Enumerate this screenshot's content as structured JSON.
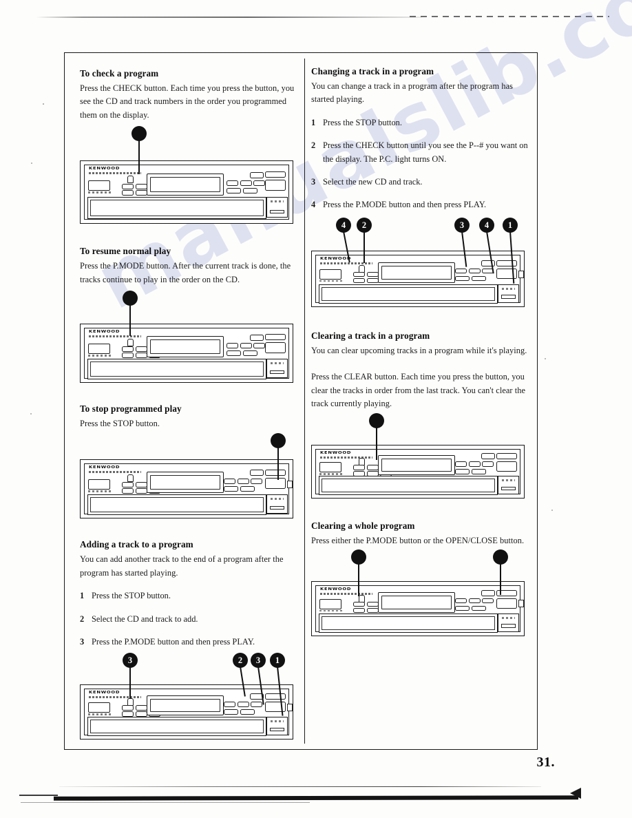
{
  "document": {
    "page_number": "31.",
    "watermark": "manualslib.com",
    "device_brand": "KENWOOD"
  },
  "left_column": {
    "sections": [
      {
        "id": "check-program",
        "heading": "To check a program",
        "body": "Press the CHECK button. Each time you press the button, you see the CD and track numbers in the order you programmed them on the display.",
        "steps": [],
        "callouts": [
          ""
        ]
      },
      {
        "id": "resume-normal-play",
        "heading": "To resume normal play",
        "body": "Press the P.MODE button. After the current track is done, the tracks continue to play in the order on the CD.",
        "steps": [],
        "callouts": [
          ""
        ]
      },
      {
        "id": "stop-programmed-play",
        "heading": "To stop programmed play",
        "body": "Press the STOP button.",
        "steps": [],
        "callouts": [
          ""
        ]
      },
      {
        "id": "adding-track",
        "heading": "Adding a track to a program",
        "body": "You can add another track to the end of a program after the program has started playing.",
        "steps": [
          {
            "num": "1",
            "text": "Press the STOP button."
          },
          {
            "num": "2",
            "text": "Select the CD and track to add."
          },
          {
            "num": "3",
            "text": "Press the P.MODE button and then press PLAY."
          }
        ],
        "callouts": [
          "3",
          "2",
          "3",
          "1"
        ]
      }
    ]
  },
  "right_column": {
    "sections": [
      {
        "id": "changing-track",
        "heading": "Changing a track in a program",
        "body": "You can change a track in a program after the program has started playing.",
        "steps": [
          {
            "num": "1",
            "text": "Press the STOP button."
          },
          {
            "num": "2",
            "text": "Press the CHECK button until you see the P--# you want on the display. The P.C. light turns ON."
          },
          {
            "num": "3",
            "text": "Select the new CD and track."
          },
          {
            "num": "4",
            "text": "Press the P.MODE button and then press PLAY."
          }
        ],
        "callouts": [
          "4",
          "2",
          "3",
          "4",
          "1"
        ]
      },
      {
        "id": "clearing-track",
        "heading": "Clearing a track in a program",
        "body": "You can clear upcoming tracks in a program while it's playing.",
        "body2": "Press the CLEAR button. Each time you press the button, you clear the tracks in order from the last track. You can't clear the track currently playing.",
        "steps": [],
        "callouts": [
          ""
        ]
      },
      {
        "id": "clearing-whole-program",
        "heading": "Clearing a whole program",
        "body": "Press either the P.MODE button or the OPEN/CLOSE button.",
        "steps": [],
        "callouts": [
          "",
          ""
        ]
      }
    ]
  },
  "colors": {
    "ink": "#111111",
    "paper": "#fdfdfc",
    "watermark": "#7884cd"
  }
}
